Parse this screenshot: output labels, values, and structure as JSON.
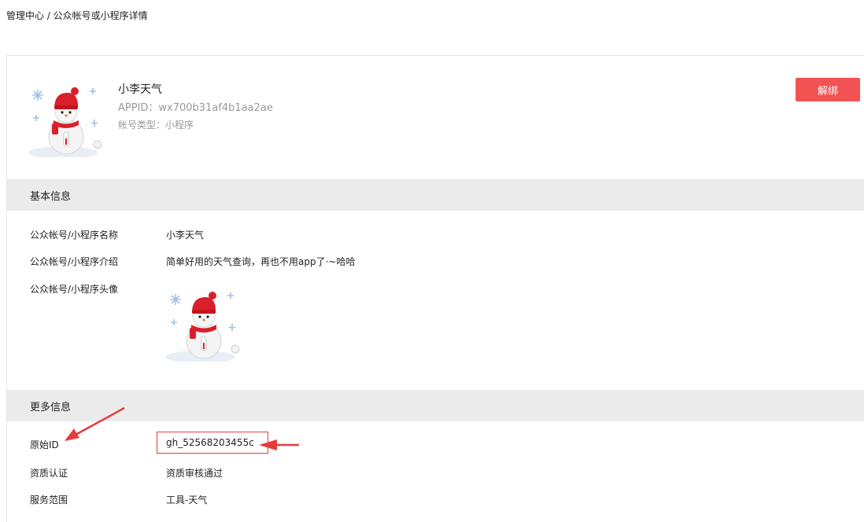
{
  "breadcrumb": "管理中心 / 公众帐号或小程序详情",
  "profile": {
    "name": "小李天气",
    "appid": "APPID：wx700b31af4b1aa2ae",
    "type": "帐号类型：小程序",
    "unbind_label": "解绑"
  },
  "basic_info": {
    "title": "基本信息",
    "fields": [
      {
        "label": "公众帐号/小程序名称",
        "value": "小李天气"
      },
      {
        "label": "公众帐号/小程序介绍",
        "value": "简单好用的天气查询，再也不用app了·~哈哈"
      },
      {
        "label": "公众帐号/小程序头像",
        "value": ""
      }
    ]
  },
  "more_info": {
    "title": "更多信息",
    "fields": [
      {
        "label": "原始ID",
        "value": "gh_52568203455c"
      },
      {
        "label": "资质认证",
        "value": "资质审核通过"
      },
      {
        "label": "服务范围",
        "value": "工具-天气"
      }
    ]
  },
  "colors": {
    "accent": "#f25252",
    "section_bg": "#ebebeb",
    "annotation": "#e63b3b"
  },
  "icons": {
    "avatar": "snowman-avatar-icon",
    "annotation_arrow": "red-arrow-icon"
  }
}
